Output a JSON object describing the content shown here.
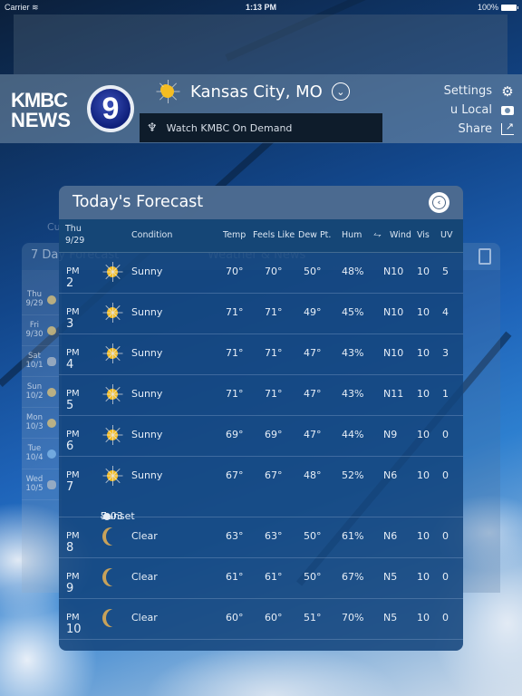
{
  "status_bar": {
    "carrier": "Carrier",
    "time": "1:13 PM",
    "battery": "100%"
  },
  "header": {
    "logo_line1": "KMBC",
    "logo_line2": "NEWS",
    "logo_channel": "9",
    "location": "Kansas City, MO",
    "location_icon": "sun-icon",
    "on_demand_label": "Watch KMBC On Demand",
    "menu": [
      {
        "label": "Settings",
        "icon": "gear-icon",
        "glyph": "⚙"
      },
      {
        "label": "u Local",
        "icon": "camera-icon",
        "glyph": "📷"
      },
      {
        "label": "Share",
        "icon": "share-icon",
        "glyph": "↗"
      }
    ]
  },
  "background": {
    "current_tab_partial": "Cu",
    "seven_day_tab": "7 Day Forecast",
    "news_tab": "Weather & News",
    "seven_day": [
      {
        "day": "Thu",
        "date": "9/29",
        "icon": "sun"
      },
      {
        "day": "Fri",
        "date": "9/30",
        "icon": "sun"
      },
      {
        "day": "Sat",
        "date": "10/1",
        "icon": "rain-cloud"
      },
      {
        "day": "Sun",
        "date": "10/2",
        "icon": "sun"
      },
      {
        "day": "Mon",
        "date": "10/3",
        "icon": "sun"
      },
      {
        "day": "Tue",
        "date": "10/4",
        "icon": "partly-cloudy"
      },
      {
        "day": "Wed",
        "date": "10/5",
        "icon": "rain-cloud"
      }
    ]
  },
  "forecast": {
    "title": "Today's Forecast",
    "columns": {
      "day": "Thu",
      "date": "9/29",
      "condition": "Condition",
      "temp": "Temp",
      "feels_like": "Feels Like",
      "dew_point": "Dew Pt.",
      "humidity": "Hum",
      "wind": "Wind",
      "visibility": "Vis",
      "uv": "UV"
    },
    "rows": [
      {
        "hour": "2",
        "ampm": "PM",
        "icon": "sun",
        "condition": "Sunny",
        "temp": "70°",
        "feels": "70°",
        "dew": "50°",
        "hum": "48%",
        "wind": "N10",
        "vis": "10",
        "uv": "5"
      },
      {
        "hour": "3",
        "ampm": "PM",
        "icon": "sun",
        "condition": "Sunny",
        "temp": "71°",
        "feels": "71°",
        "dew": "49°",
        "hum": "45%",
        "wind": "N10",
        "vis": "10",
        "uv": "4"
      },
      {
        "hour": "4",
        "ampm": "PM",
        "icon": "sun",
        "condition": "Sunny",
        "temp": "71°",
        "feels": "71°",
        "dew": "47°",
        "hum": "43%",
        "wind": "N10",
        "vis": "10",
        "uv": "3"
      },
      {
        "hour": "5",
        "ampm": "PM",
        "icon": "sun",
        "condition": "Sunny",
        "temp": "71°",
        "feels": "71°",
        "dew": "47°",
        "hum": "43%",
        "wind": "N11",
        "vis": "10",
        "uv": "1"
      },
      {
        "hour": "6",
        "ampm": "PM",
        "icon": "sun",
        "condition": "Sunny",
        "temp": "69°",
        "feels": "69°",
        "dew": "47°",
        "hum": "44%",
        "wind": "N9",
        "vis": "10",
        "uv": "0"
      },
      {
        "hour": "7",
        "ampm": "PM",
        "icon": "sun",
        "condition": "Sunny",
        "temp": "67°",
        "feels": "67°",
        "dew": "48°",
        "hum": "52%",
        "wind": "N6",
        "vis": "10",
        "uv": "0",
        "event_time": "7:03",
        "event_label": "Sunset"
      },
      {
        "hour": "8",
        "ampm": "PM",
        "icon": "moon",
        "condition": "Clear",
        "temp": "63°",
        "feels": "63°",
        "dew": "50°",
        "hum": "61%",
        "wind": "N6",
        "vis": "10",
        "uv": "0"
      },
      {
        "hour": "9",
        "ampm": "PM",
        "icon": "moon",
        "condition": "Clear",
        "temp": "61°",
        "feels": "61°",
        "dew": "50°",
        "hum": "67%",
        "wind": "N5",
        "vis": "10",
        "uv": "0"
      },
      {
        "hour": "10",
        "ampm": "PM",
        "icon": "moon",
        "condition": "Clear",
        "temp": "60°",
        "feels": "60°",
        "dew": "51°",
        "hum": "70%",
        "wind": "N5",
        "vis": "10",
        "uv": "0"
      }
    ]
  }
}
